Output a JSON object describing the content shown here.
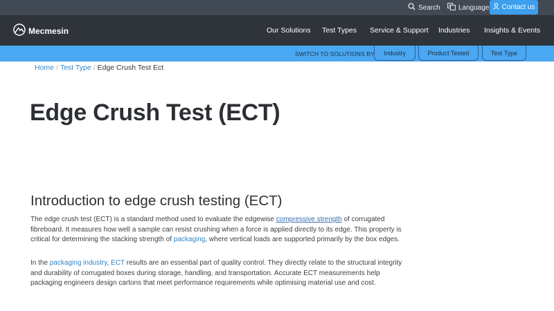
{
  "utility": {
    "search_label": "Search",
    "language_label": "Language",
    "contact_label": "Contact us"
  },
  "nav": {
    "brand": "Mecmesin",
    "items": [
      "Our Solutions",
      "Test Types",
      "Service & Support",
      "Industries",
      "Insights & Events"
    ]
  },
  "solutions_strip": {
    "label": "SWITCH TO SOLUTIONS BY",
    "options": [
      "Industry",
      "Product Tested",
      "Test Type"
    ]
  },
  "breadcrumb": {
    "items": [
      "Home",
      "Test Type",
      "Edge Crush Test Ect"
    ],
    "separator": "/"
  },
  "page": {
    "title": "Edge Crush Test (ECT)",
    "section_heading": "Introduction to edge crush testing (ECT)",
    "para1": {
      "part1": "The edge crush test (ECT) is a standard method used to evaluate the edgewise ",
      "link1": "compressive strength",
      "part2": " of corrugated fibreboard. It measures how well a sample can resist crushing when a force is applied directly to its edge. This property is critical for determining the stacking strength of ",
      "link2": "packaging",
      "part3": ", where vertical loads are supported primarily by the box edges."
    },
    "para2": {
      "part1": "In the ",
      "link1": "packaging industry",
      "part2": ", ",
      "link2": "ECT",
      "part3": " results are an essential part of quality control. They directly relate to the structural integrity and durability of corrugated boxes during storage, handling, and transportation. Accurate ECT measurements help packaging engineers design cartons that meet performance requirements while optimising material use and cost."
    }
  },
  "colors": {
    "utility_bar": "#414954",
    "main_nav": "#2f343b",
    "accent_blue": "#4aa7f1",
    "contact_button": "#3e9fee",
    "link": "#2f86c9"
  }
}
